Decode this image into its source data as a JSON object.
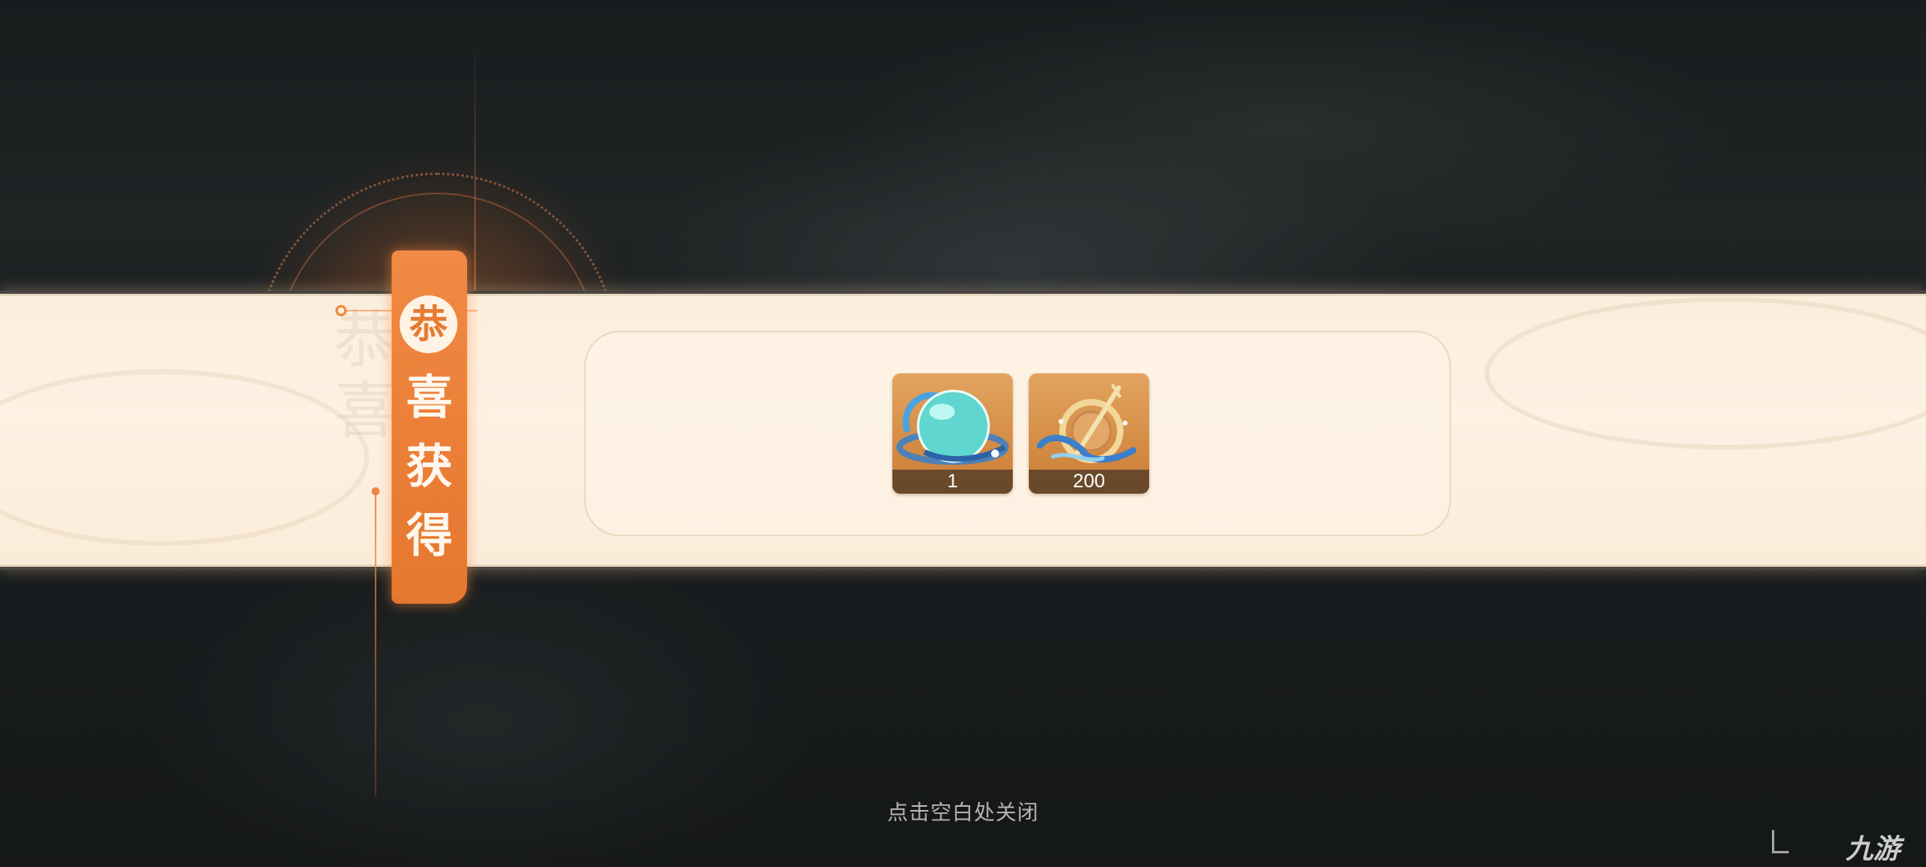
{
  "badge": {
    "circle_char": "恭",
    "chars": [
      "喜",
      "获",
      "得"
    ]
  },
  "ghost_text": [
    "恭",
    "喜"
  ],
  "rewards": [
    {
      "name": "蓝色宝珠",
      "icon": "crystal-orb-icon",
      "count": "1"
    },
    {
      "name": "星轨罗盘",
      "icon": "compass-star-icon",
      "count": "200"
    }
  ],
  "close_hint": "点击空白处关闭",
  "watermark": "九游",
  "colors": {
    "accent": "#eb7f37",
    "banner": "#fbeedd",
    "item_bg": "#d48c44"
  }
}
